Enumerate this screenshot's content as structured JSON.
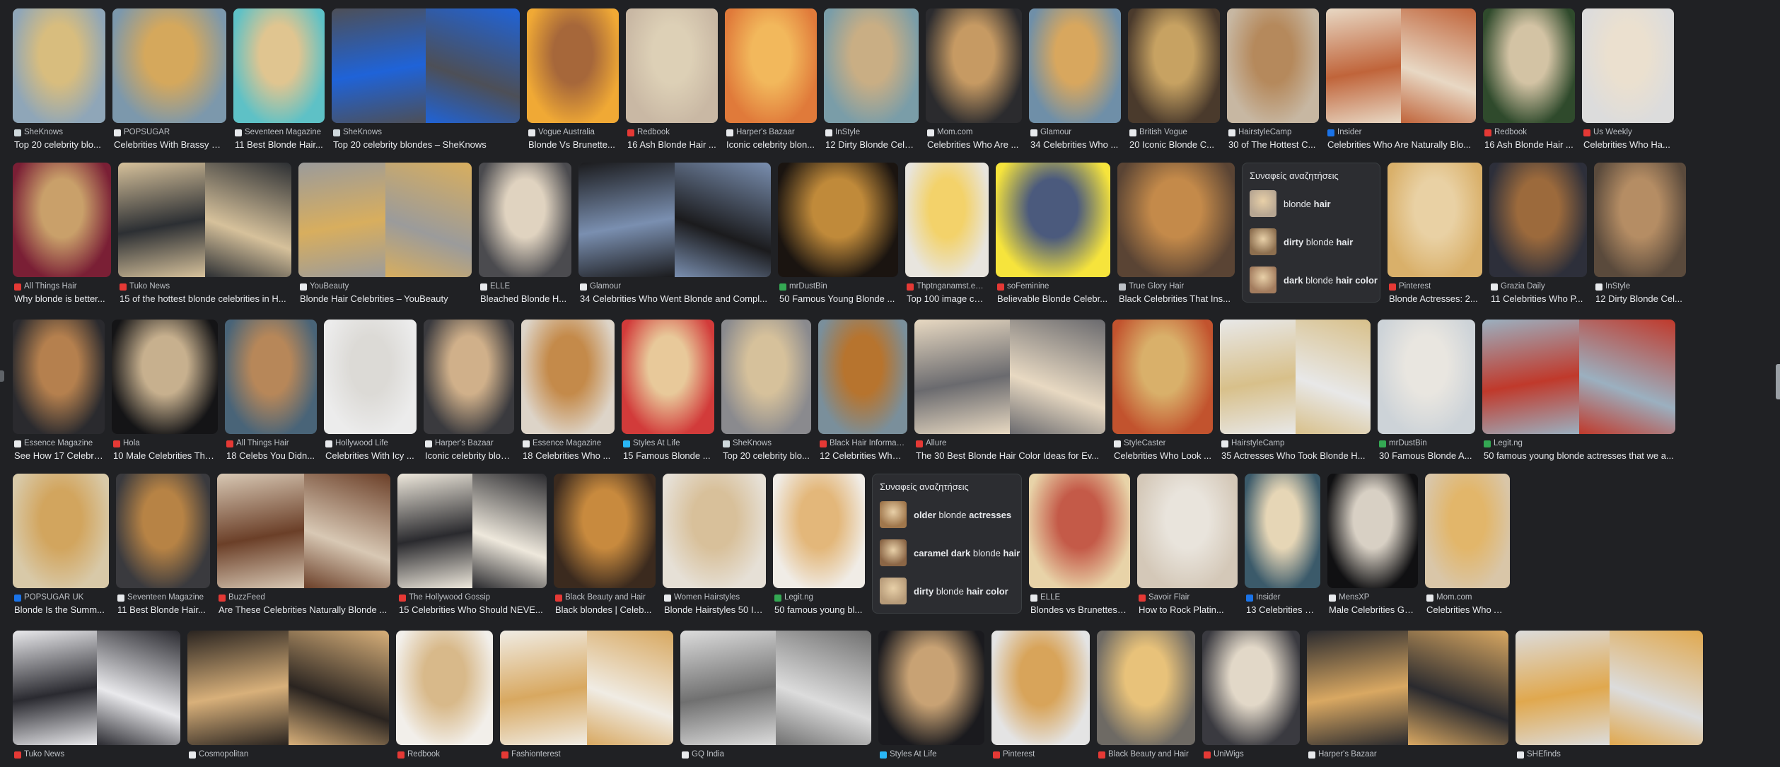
{
  "rows": [
    {
      "tiles": [
        {
          "source": "SheKnows",
          "title": "Top 20 celebrity blo...",
          "c1": "#8fa6b8",
          "c2": "#d8bd7e",
          "favicon": "#cfd8dc"
        },
        {
          "source": "POPSUGAR",
          "title": "Celebrities With Brassy B...",
          "c1": "#7c98ac",
          "c2": "#d5a85c",
          "favicon": "#e8eaed"
        },
        {
          "source": "Seventeen Magazine",
          "title": "11 Best Blonde Hair...",
          "c1": "#5ec1c6",
          "c2": "#e0c590",
          "favicon": "#e8eaed"
        },
        {
          "source": "SheKnows",
          "title": "Top 20 celebrity blondes – SheKnows",
          "c1": "#4d4f57",
          "c2": "#1f63d8",
          "favicon": "#cfd8dc"
        },
        {
          "source": "Vogue Australia",
          "title": "Blonde Vs Brunette...",
          "c1": "#f0a935",
          "c2": "#a6673a",
          "favicon": "#e8eaed"
        },
        {
          "source": "Redbook",
          "title": "16 Ash Blonde Hair ...",
          "c1": "#c9b8a4",
          "c2": "#ddd0b6",
          "favicon": "#e53935"
        },
        {
          "source": "Harper's Bazaar",
          "title": "Iconic celebrity blon...",
          "c1": "#e07a3a",
          "c2": "#f2b85c",
          "favicon": "#e8eaed"
        },
        {
          "source": "InStyle",
          "title": "12 Dirty Blonde Cele...",
          "c1": "#7a9da8",
          "c2": "#c9ae84",
          "favicon": "#e8eaed"
        },
        {
          "source": "Mom.com",
          "title": "Celebrities Who Are ...",
          "c1": "#2b2b2e",
          "c2": "#c69a63",
          "favicon": "#e8eaed"
        },
        {
          "source": "Glamour",
          "title": "34 Celebrities Who ...",
          "c1": "#6f8fa8",
          "c2": "#d8a75e",
          "favicon": "#e8eaed"
        },
        {
          "source": "British Vogue",
          "title": "20 Iconic Blonde C...",
          "c1": "#4a3a2c",
          "c2": "#c7a262",
          "favicon": "#e8eaed"
        },
        {
          "source": "HairstyleCamp",
          "title": "30 of The Hottest C...",
          "c1": "#c7b7a2",
          "c2": "#b5895c",
          "favicon": "#e8eaed"
        },
        {
          "source": "Insider",
          "title": "Celebrities Who Are Naturally Blo...",
          "c1": "#e8d8c4",
          "c2": "#c0643a",
          "favicon": "#1a73e8"
        },
        {
          "source": "Redbook",
          "title": "16 Ash Blonde Hair ...",
          "c1": "#2f4a2c",
          "c2": "#d3c3a4",
          "favicon": "#e53935"
        },
        {
          "source": "Us Weekly",
          "title": "Celebrities Who Ha...",
          "c1": "#dcdcdc",
          "c2": "#ebe0cf",
          "favicon": "#e53935"
        }
      ]
    },
    {
      "tiles": [
        {
          "source": "All Things Hair",
          "title": "Why blonde is better...",
          "c1": "#7a1f35",
          "c2": "#c9a06a",
          "favicon": "#e53935"
        },
        {
          "source": "Tuko News",
          "title": "15 of the hottest blonde celebrities in H...",
          "c1": "#d6c19b",
          "c2": "#2c2f33",
          "favicon": "#e53935"
        },
        {
          "source": "YouBeauty",
          "title": "Blonde Hair Celebrities – YouBeauty",
          "c1": "#9b9b9b",
          "c2": "#d8ae5e",
          "favicon": "#e8eaed"
        },
        {
          "source": "ELLE",
          "title": "Bleached Blonde H...",
          "c1": "#4b4b4f",
          "c2": "#e0d3c0",
          "favicon": "#e8eaed"
        },
        {
          "source": "Glamour",
          "title": "34 Celebrities Who Went Blonde and Compl...",
          "c1": "#1b1b1d",
          "c2": "#7a8fb0",
          "favicon": "#e8eaed"
        },
        {
          "source": "mrDustBin",
          "title": "50 Famous Young Blonde ...",
          "c1": "#1a1410",
          "c2": "#c08a3a",
          "favicon": "#34a853"
        },
        {
          "source": "Thptnganamst.edu....",
          "title": "Top 100 image cele...",
          "c1": "#e8e5de",
          "c2": "#f3d26a",
          "favicon": "#e53935"
        },
        {
          "source": "soFeminine",
          "title": "Believable Blonde Celebr...",
          "c1": "#f6e43c",
          "c2": "#4b5a7d",
          "favicon": "#e53935"
        },
        {
          "source": "True Glory Hair",
          "title": "Black Celebrities That Ins...",
          "c1": "#5a4434",
          "c2": "#c48a4a",
          "favicon": "#bdc1c6"
        }
      ],
      "related": {
        "heading": "Συναφείς αναζητήσεις",
        "items": [
          {
            "bold_prefix": "",
            "normal": "blonde ",
            "bold_suffix": "hair",
            "thumb": "#b7a692"
          },
          {
            "bold_prefix": "dirty ",
            "normal": "blonde ",
            "bold_suffix": "hair",
            "thumb": "#8d6f4f"
          },
          {
            "bold_prefix": "dark ",
            "normal": "blonde ",
            "bold_suffix": "hair color",
            "thumb": "#a37c5e"
          }
        ]
      },
      "tiles_after": [
        {
          "source": "Pinterest",
          "title": "Blonde Actresses: 2...",
          "c1": "#d9b06a",
          "c2": "#e9d1a4",
          "favicon": "#e53935"
        },
        {
          "source": "Grazia Daily",
          "title": "11 Celebrities Who P...",
          "c1": "#2d2f3a",
          "c2": "#9c6a3c",
          "favicon": "#e8eaed"
        },
        {
          "source": "InStyle",
          "title": "12 Dirty Blonde Cel...",
          "c1": "#5a4a3c",
          "c2": "#b58d64",
          "favicon": "#e8eaed"
        }
      ]
    },
    {
      "tiles": [
        {
          "source": "Essence Magazine",
          "title": "See How 17 Celebri...",
          "c1": "#2a2a2e",
          "c2": "#b5804e",
          "favicon": "#e8eaed"
        },
        {
          "source": "Hola",
          "title": "10 Male Celebrities Tha...",
          "c1": "#141416",
          "c2": "#c7b08e",
          "favicon": "#e53935"
        },
        {
          "source": "All Things Hair",
          "title": "18 Celebs You Didn...",
          "c1": "#496478",
          "c2": "#b78759",
          "favicon": "#e53935"
        },
        {
          "source": "Hollywood Life",
          "title": "Celebrities With Icy ...",
          "c1": "#ececec",
          "c2": "#dcdad6",
          "favicon": "#e8eaed"
        },
        {
          "source": "Harper's Bazaar",
          "title": "Iconic celebrity blon...",
          "c1": "#3a3a3e",
          "c2": "#d0b08a",
          "favicon": "#e8eaed"
        },
        {
          "source": "Essence Magazine",
          "title": "18 Celebrities Who ...",
          "c1": "#ddd4c8",
          "c2": "#c48a4a",
          "favicon": "#e8eaed"
        },
        {
          "source": "Styles At Life",
          "title": "15 Famous Blonde ...",
          "c1": "#d23b3a",
          "c2": "#e8c99a",
          "favicon": "#29b6f6"
        },
        {
          "source": "SheKnows",
          "title": "Top 20 celebrity blo...",
          "c1": "#8a8a8e",
          "c2": "#d6c19b",
          "favicon": "#cfd8dc"
        },
        {
          "source": "Black Hair Informati...",
          "title": "12 Celebrities Who ...",
          "c1": "#7a8f9b",
          "c2": "#b7742e",
          "favicon": "#e53935"
        },
        {
          "source": "Allure",
          "title": "The 30 Best Blonde Hair Color Ideas for Ev...",
          "c1": "#e8d9c2",
          "c2": "#6a6a6e",
          "favicon": "#e53935"
        },
        {
          "source": "StyleCaster",
          "title": "Celebrities Who Look ...",
          "c1": "#c2532e",
          "c2": "#d9b06a",
          "favicon": "#e8eaed"
        },
        {
          "source": "HairstyleCamp",
          "title": "35 Actresses Who Took Blonde H...",
          "c1": "#e8e8e8",
          "c2": "#d8c08a",
          "favicon": "#e8eaed"
        },
        {
          "source": "mrDustBin",
          "title": "30 Famous Blonde A...",
          "c1": "#cdd3d8",
          "c2": "#e9e6e0",
          "favicon": "#34a853"
        },
        {
          "source": "Legit.ng",
          "title": "50 famous young blonde actresses that we a...",
          "c1": "#9bb0c0",
          "c2": "#c0392b",
          "favicon": "#34a853"
        }
      ]
    },
    {
      "tiles": [
        {
          "source": "POPSUGAR UK",
          "title": "Blonde Is the Summ...",
          "c1": "#d8c9a8",
          "c2": "#d2a55e",
          "favicon": "#1a73e8"
        },
        {
          "source": "Seventeen Magazine",
          "title": "11 Best Blonde Hair...",
          "c1": "#3a3a3e",
          "c2": "#b78345",
          "favicon": "#e8eaed"
        },
        {
          "source": "BuzzFeed",
          "title": "Are These Celebrities Naturally Blonde ...",
          "c1": "#d8c8b4",
          "c2": "#6b3f28",
          "favicon": "#e53935"
        },
        {
          "source": "The Hollywood Gossip",
          "title": "15 Celebrities Who Should NEVE...",
          "c1": "#eee8dc",
          "c2": "#2a2a2e",
          "favicon": "#e53935"
        },
        {
          "source": "Black Beauty and Hair",
          "title": "Black blondes | Celeb...",
          "c1": "#3b2a1e",
          "c2": "#c88a3e",
          "favicon": "#e53935"
        },
        {
          "source": "Women Hairstyles",
          "title": "Blonde Hairstyles 50 Id...",
          "c1": "#e6e0d6",
          "c2": "#d8c09a",
          "favicon": "#e8eaed"
        },
        {
          "source": "Legit.ng",
          "title": "50 famous young bl...",
          "c1": "#f0ece6",
          "c2": "#e3b77a",
          "favicon": "#34a853"
        }
      ],
      "related": {
        "heading": "Συναφείς αναζητήσεις",
        "items": [
          {
            "bold_prefix": "older ",
            "normal": "blonde ",
            "bold_suffix": "actresses",
            "thumb": "#a0774c"
          },
          {
            "bold_prefix": "caramel dark ",
            "normal": "blonde ",
            "bold_suffix": "hair",
            "thumb": "#8b6646"
          },
          {
            "bold_prefix": "dirty ",
            "normal": "blonde ",
            "bold_suffix": "hair color",
            "thumb": "#b79b79"
          }
        ]
      },
      "tiles_after": [
        {
          "source": "ELLE",
          "title": "Blondes vs Brunettes - Celebrity Blonde and Br...",
          "c1": "#e8d3a8",
          "c2": "#c45a48",
          "favicon": "#e8eaed"
        },
        {
          "source": "Savoir Flair",
          "title": "How to Rock Platin...",
          "c1": "#d4c8b8",
          "c2": "#e9e4dc",
          "favicon": "#e53935"
        },
        {
          "source": "Insider",
          "title": "13 Celebrities Who Have Gone Bl...",
          "c1": "#3b5a6a",
          "c2": "#e6d6b6",
          "favicon": "#1a73e8"
        },
        {
          "source": "MensXP",
          "title": "Male Celebrities Go...",
          "c1": "#101012",
          "c2": "#d8d0c4",
          "favicon": "#e8eaed"
        },
        {
          "source": "Mom.com",
          "title": "Celebrities Who Are...",
          "c1": "#d9c6a8",
          "c2": "#e2b66a",
          "favicon": "#e8eaed"
        }
      ]
    },
    {
      "tiles": [
        {
          "source": "Tuko News",
          "title": "",
          "c1": "#e9e9ec",
          "c2": "#2a2a30",
          "favicon": "#e53935"
        },
        {
          "source": "Cosmopolitan",
          "title": "",
          "c1": "#2a2420",
          "c2": "#d8b07a",
          "favicon": "#e8eaed"
        },
        {
          "source": "Redbook",
          "title": "",
          "c1": "#f2efea",
          "c2": "#d8b98a",
          "favicon": "#e53935"
        },
        {
          "source": "Fashionterest",
          "title": "",
          "c1": "#f0ece4",
          "c2": "#d8a860",
          "favicon": "#e53935"
        },
        {
          "source": "GQ India",
          "title": "",
          "c1": "#dcdcdc",
          "c2": "#707070",
          "favicon": "#e8eaed"
        },
        {
          "source": "Styles At Life",
          "title": "",
          "c1": "#1a1a1e",
          "c2": "#c8a274",
          "favicon": "#29b6f6"
        },
        {
          "source": "Pinterest",
          "title": "",
          "c1": "#e4e4e4",
          "c2": "#d8a45a",
          "favicon": "#e53935"
        },
        {
          "source": "Black Beauty and Hair",
          "title": "",
          "c1": "#6e6a64",
          "c2": "#e8c27a",
          "favicon": "#e53935"
        },
        {
          "source": "UniWigs",
          "title": "",
          "c1": "#3a3a40",
          "c2": "#e2d8c8",
          "favicon": "#e53935"
        },
        {
          "source": "Harper's Bazaar",
          "title": "",
          "c1": "#2a2a2e",
          "c2": "#d9a862",
          "favicon": "#e8eaed"
        },
        {
          "source": "SHEfinds",
          "title": "",
          "c1": "#dcdcdc",
          "c2": "#e0a84e",
          "favicon": "#e8eaed"
        }
      ]
    }
  ]
}
